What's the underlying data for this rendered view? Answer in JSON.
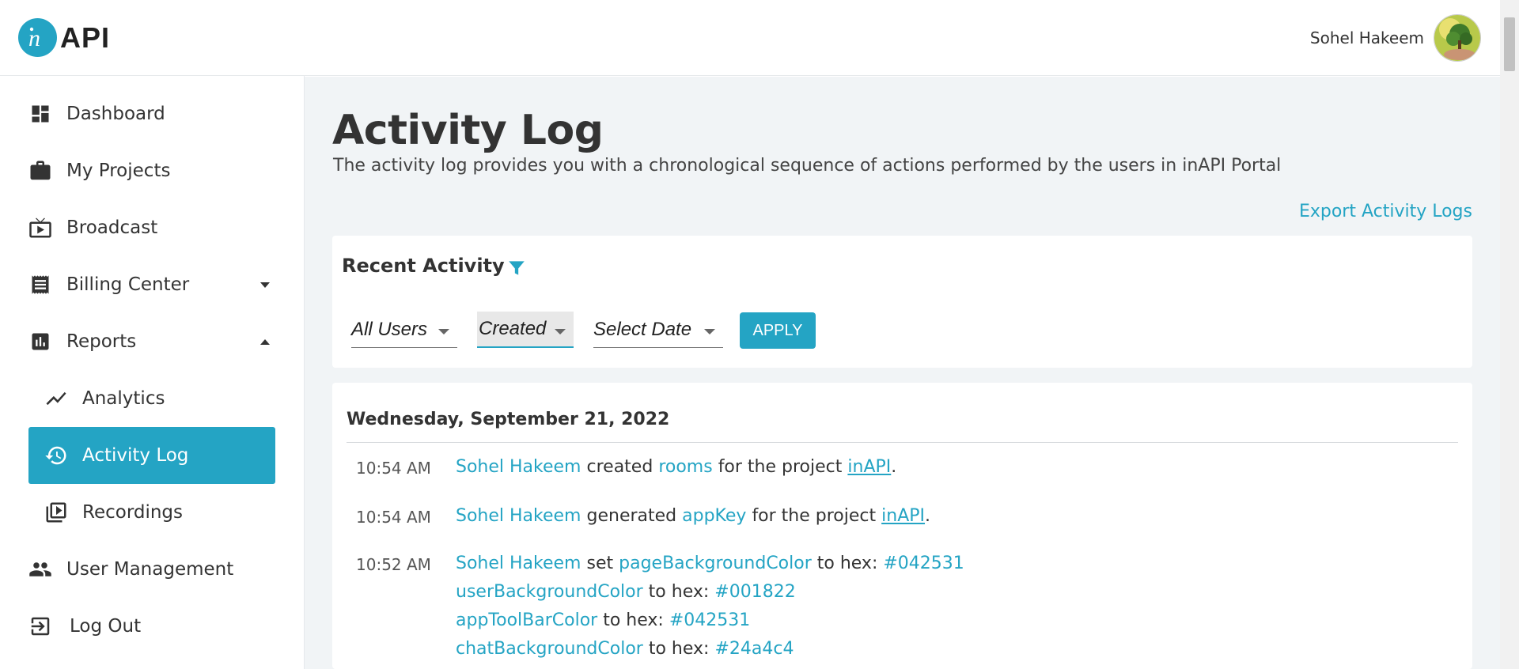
{
  "header": {
    "logo_text": "API",
    "user_name": "Sohel Hakeem"
  },
  "sidebar": {
    "items": [
      {
        "label": "Dashboard",
        "icon": "dashboard-icon"
      },
      {
        "label": "My Projects",
        "icon": "briefcase-icon"
      },
      {
        "label": "Broadcast",
        "icon": "tv-icon"
      },
      {
        "label": "Billing Center",
        "icon": "receipt-icon"
      },
      {
        "label": "Reports",
        "icon": "bar-chart-icon"
      },
      {
        "label": "Analytics",
        "icon": "trending-icon"
      },
      {
        "label": "Activity Log",
        "icon": "history-icon"
      },
      {
        "label": "Recordings",
        "icon": "video-library-icon"
      },
      {
        "label": "User Management",
        "icon": "people-icon"
      },
      {
        "label": "Log Out",
        "icon": "logout-icon"
      }
    ]
  },
  "main": {
    "title": "Activity Log",
    "subtitle": "The activity log provides you with a chronological sequence of actions performed by the users in inAPI Portal",
    "export_label": "Export Activity Logs",
    "recent_title": "Recent Activity",
    "filters": {
      "users": "All Users",
      "action": "Created",
      "date": "Select Date",
      "apply_label": "APPLY"
    },
    "log": {
      "date": "Wednesday, September 21, 2022",
      "entries": [
        {
          "time": "10:54 AM",
          "user": "Sohel Hakeem",
          "verb": "created",
          "object": "rooms",
          "middle": "for the project",
          "project": "inAPI",
          "end": "."
        },
        {
          "time": "10:54 AM",
          "user": "Sohel Hakeem",
          "verb": "generated",
          "object": "appKey",
          "middle": "for the project",
          "project": "inAPI",
          "end": "."
        },
        {
          "time": "10:52 AM",
          "user": "Sohel Hakeem",
          "verb": "set",
          "tohex": "to hex:",
          "lines": [
            {
              "prop": "pageBackgroundColor",
              "hex": "#042531"
            },
            {
              "prop": "userBackgroundColor",
              "hex": "#001822"
            },
            {
              "prop": "appToolBarColor",
              "hex": "#042531"
            },
            {
              "prop": "chatBackgroundColor",
              "hex": "#24a4c4"
            }
          ]
        }
      ]
    }
  },
  "colors": {
    "accent": "#24a4c4",
    "background": "#f1f4f6"
  }
}
